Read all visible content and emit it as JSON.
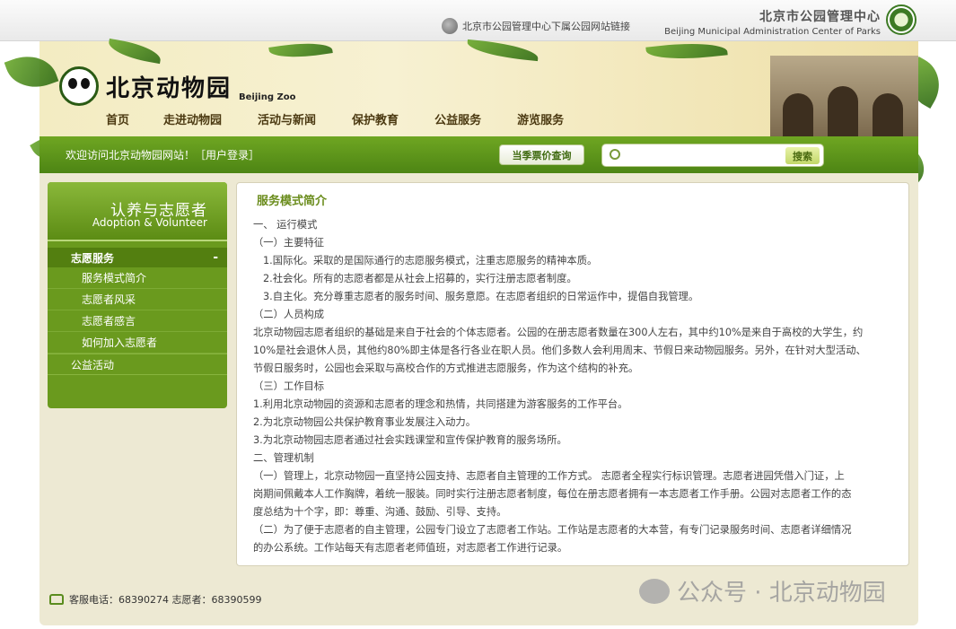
{
  "topbar": {
    "parks_link": "北京市公园管理中心下属公园网站链接",
    "org_cn": "北京市公园管理中心",
    "org_en": "Beijing Municipal Administration Center of Parks"
  },
  "header": {
    "logo_cn": "北京动物园",
    "logo_en": "Beijing Zoo",
    "nav": [
      "首页",
      "走进动物园",
      "活动与新闻",
      "保护教育",
      "公益服务",
      "游览服务"
    ],
    "active_nav_index": 4
  },
  "bar": {
    "welcome": "欢迎访问北京动物园网站！",
    "login": "［用户登录］",
    "ticket_button": "当季票价查询",
    "search_placeholder": "",
    "search_button": "搜索"
  },
  "sidebar": {
    "title_cn": "认养与志愿者",
    "title_en": "Adoption & Volunteer",
    "section": "志愿服务",
    "collapse_symbol": "-",
    "items": [
      "服务模式简介",
      "志愿者风采",
      "志愿者感言",
      "如何加入志愿者"
    ],
    "section2": "公益活动"
  },
  "article": {
    "title": "服务模式简介",
    "lines": [
      "一、 运行模式",
      "（一）主要特征",
      "1.国际化。采取的是国际通行的志愿服务模式，注重志愿服务的精神本质。",
      "2.社会化。所有的志愿者都是从社会上招募的，实行注册志愿者制度。",
      "3.自主化。充分尊重志愿者的服务时间、服务意愿。在志愿者组织的日常运作中，提倡自我管理。",
      "（二）人员构成",
      "北京动物园志愿者组织的基础是来自于社会的个体志愿者。公园的在册志愿者数量在300人左右，其中约10%是来自于高校的大学生，约",
      "10%是社会退休人员，其他约80%即主体是各行各业在职人员。他们多数人会利用周末、节假日来动物园服务。另外，在针对大型活动、",
      "节假日服务时，公园也会采取与高校合作的方式推进志愿服务，作为这个结构的补充。",
      "（三）工作目标",
      "1.利用北京动物园的资源和志愿者的理念和热情，共同搭建为游客服务的工作平台。",
      "2.为北京动物园公共保护教育事业发展注入动力。",
      "3.为北京动物园志愿者通过社会实践课堂和宣传保护教育的服务场所。",
      "二、管理机制",
      "（一）管理上，北京动物园一直坚持公园支持、志愿者自主管理的工作方式。 志愿者全程实行标识管理。志愿者进园凭借入门证，上",
      "岗期间佩戴本人工作胸牌，着统一服装。同时实行注册志愿者制度，每位在册志愿者拥有一本志愿者工作手册。公园对志愿者工作的态",
      "度总结为十个字，即：尊重、沟通、鼓励、引导、支持。",
      "（二）为了便于志愿者的自主管理，公园专门设立了志愿者工作站。工作站是志愿者的大本营，有专门记录服务时间、志愿者详细情况",
      "的办公系统。工作站每天有志愿者老师值班，对志愿者工作进行记录。"
    ],
    "indented_line_indices": [
      2,
      3,
      4
    ]
  },
  "footer": {
    "phones": "客服电话：68390274 志愿者：68390599"
  },
  "watermark": {
    "text": "公众号 · 北京动物园"
  },
  "colors": {
    "nav_active_ring": "#e03030",
    "green_bar": "#5a9418",
    "sidebar_bg": "#6a9a1e",
    "article_title": "#6a8c1c"
  }
}
